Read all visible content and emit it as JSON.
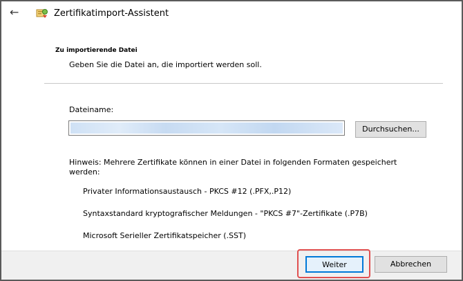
{
  "window": {
    "title": "Zertifikatimport-Assistent",
    "back_icon": "arrow-left-icon",
    "wizard_icon": "certificate-wizard-icon"
  },
  "section": {
    "heading": "Zu importierende Datei",
    "subheading": "Geben Sie die Datei an, die importiert werden soll."
  },
  "file": {
    "label": "Dateiname:",
    "value": "",
    "value_redacted": true,
    "browse_label": "Durchsuchen..."
  },
  "hint": {
    "text": "Hinweis: Mehrere Zertifikate können in einer Datei in folgenden Formaten gespeichert werden:",
    "formats": [
      "Privater Informationsaustausch - PKCS #12 (.PFX,.P12)",
      "Syntaxstandard kryptografischer Meldungen - \"PKCS #7\"-Zertifikate (.P7B)",
      "Microsoft Serieller Zertifikatspeicher (.SST)"
    ]
  },
  "footer": {
    "next_label": "Weiter",
    "cancel_label": "Abbrechen",
    "highlight_color": "#e05050"
  },
  "colors": {
    "accent": "#0078d7",
    "footer_bg": "#f0f0f0"
  }
}
